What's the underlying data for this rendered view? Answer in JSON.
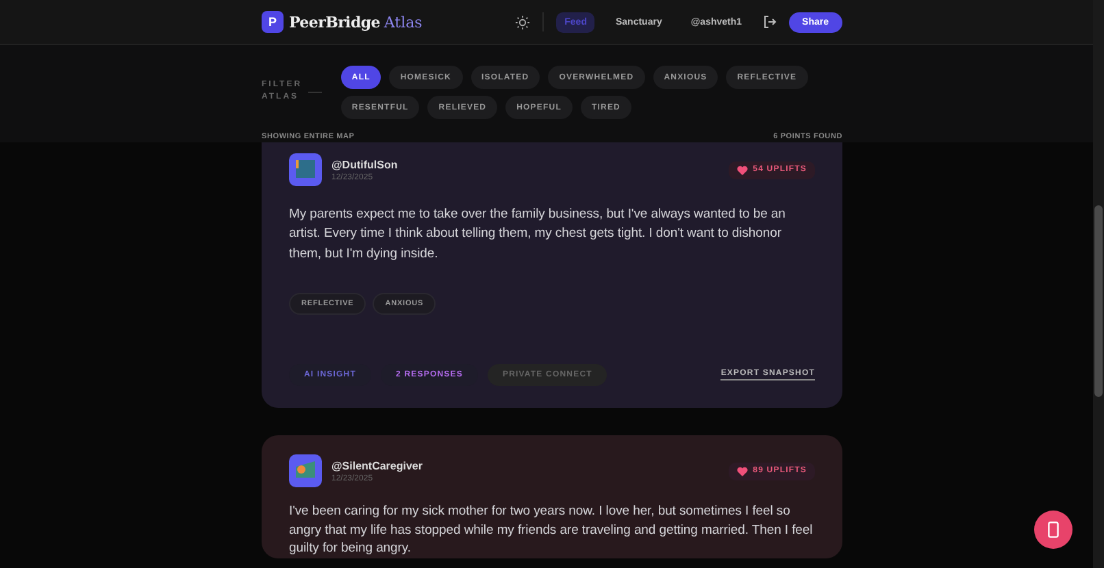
{
  "header": {
    "logo_letter": "P",
    "brand": "PeerBridge",
    "brand_accent": "Atlas",
    "nav": [
      {
        "label": "Feed",
        "selected": true
      },
      {
        "label": "Sanctuary",
        "selected": false
      },
      {
        "label": "@ashveth1",
        "selected": false
      }
    ],
    "share": "Share"
  },
  "filter": {
    "label": "FILTER ATLAS",
    "chips": [
      {
        "label": "ALL",
        "selected": true
      },
      {
        "label": "HOMESICK",
        "selected": false
      },
      {
        "label": "ISOLATED",
        "selected": false
      },
      {
        "label": "OVERWHELMED",
        "selected": false
      },
      {
        "label": "ANXIOUS",
        "selected": false
      },
      {
        "label": "REFLECTIVE",
        "selected": false
      },
      {
        "label": "RESENTFUL",
        "selected": false
      },
      {
        "label": "RELIEVED",
        "selected": false
      },
      {
        "label": "HOPEFUL",
        "selected": false
      },
      {
        "label": "TIRED",
        "selected": false
      }
    ],
    "status": "SHOWING ENTIRE MAP",
    "count": "6 POINTS FOUND"
  },
  "posts": [
    {
      "color": "#201b2c",
      "user": "@DutifulSon",
      "date": "12/23/2025",
      "uplifts": "54 UPLIFTS",
      "body": "My parents expect me to take over the family business, but I've always wanted to be an artist. Every time I think about telling them, my chest gets tight. I don't want to dishonor them, but I'm dying inside.",
      "tags": [
        "REFLECTIVE",
        "ANXIOUS"
      ],
      "actions": {
        "insight": "AI INSIGHT",
        "responses": "2 RESPONSES",
        "connect": "PRIVATE CONNECT",
        "export": "EXPORT SNAPSHOT"
      }
    },
    {
      "color": "#28191d",
      "user": "@SilentCaregiver",
      "date": "12/23/2025",
      "uplifts": "89 UPLIFTS",
      "body": "I've been caring for my sick mother for two years now. I love her, but sometimes I feel so angry that my life has stopped while my friends are traveling and getting married. Then I feel guilty for being angry."
    }
  ]
}
